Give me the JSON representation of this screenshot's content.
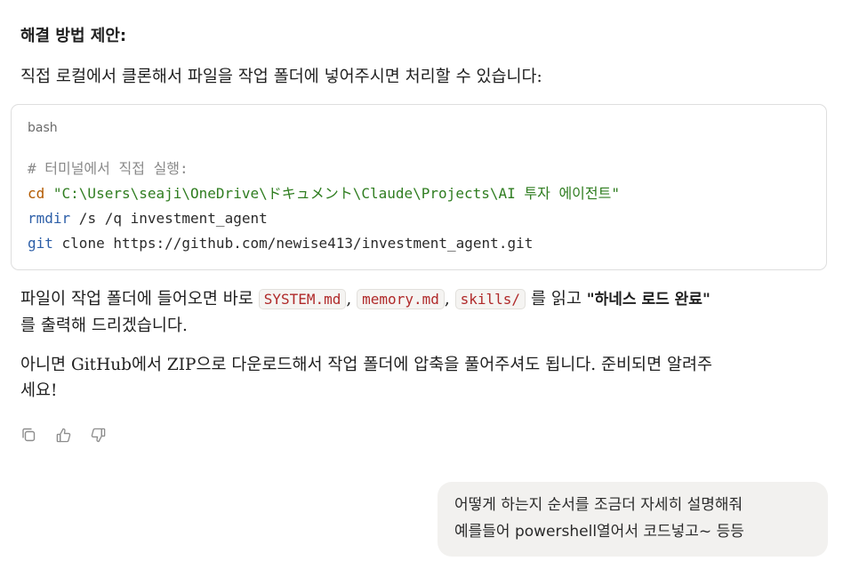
{
  "assistant": {
    "heading": "해결 방법 제안:",
    "intro": "직접 로컬에서 클론해서 파일을 작업 폴더에 넣어주시면 처리할 수 있습니다:",
    "code_block": {
      "language": "bash",
      "comment": "# 터미널에서 직접 실행:",
      "line2_cmd": "cd",
      "line2_path": " \"C:\\Users\\seaji\\OneDrive\\ドキュメント\\Claude\\Projects\\AI 투자 에이전트\"",
      "line3_cmd": "rmdir",
      "line3_args": " /s /q investment_agent",
      "line4_cmd": "git",
      "line4_args": " clone https://github.com/newise413/investment_agent.git"
    },
    "read_para": {
      "before": "파일이 작업 폴더에 들어오면 바로 ",
      "file1": "SYSTEM.md",
      "sep1": ", ",
      "file2": "memory.md",
      "sep2": ", ",
      "file3": "skills/",
      "middle": " 를 읽고 ",
      "bold": "\"하네스 로드 완료\"",
      "after": "를 출력해 드리겠습니다."
    },
    "zip_para": {
      "line1": "아니면 GitHub에서 ZIP으로 다운로드해서 작업 폴더에 압축을 풀어주셔도 됩니다. 준비되면 알려주",
      "line2": "세요!"
    },
    "actions": {
      "copy": "copy-icon",
      "thumbs_up": "thumbs-up-icon",
      "thumbs_down": "thumbs-down-icon"
    }
  },
  "user_message": {
    "line1": "어떻게 하는지 순서를 조금더 자세히 설명해줘",
    "line2": "예를들어 powershell열어서  코드넣고~ 등등"
  }
}
